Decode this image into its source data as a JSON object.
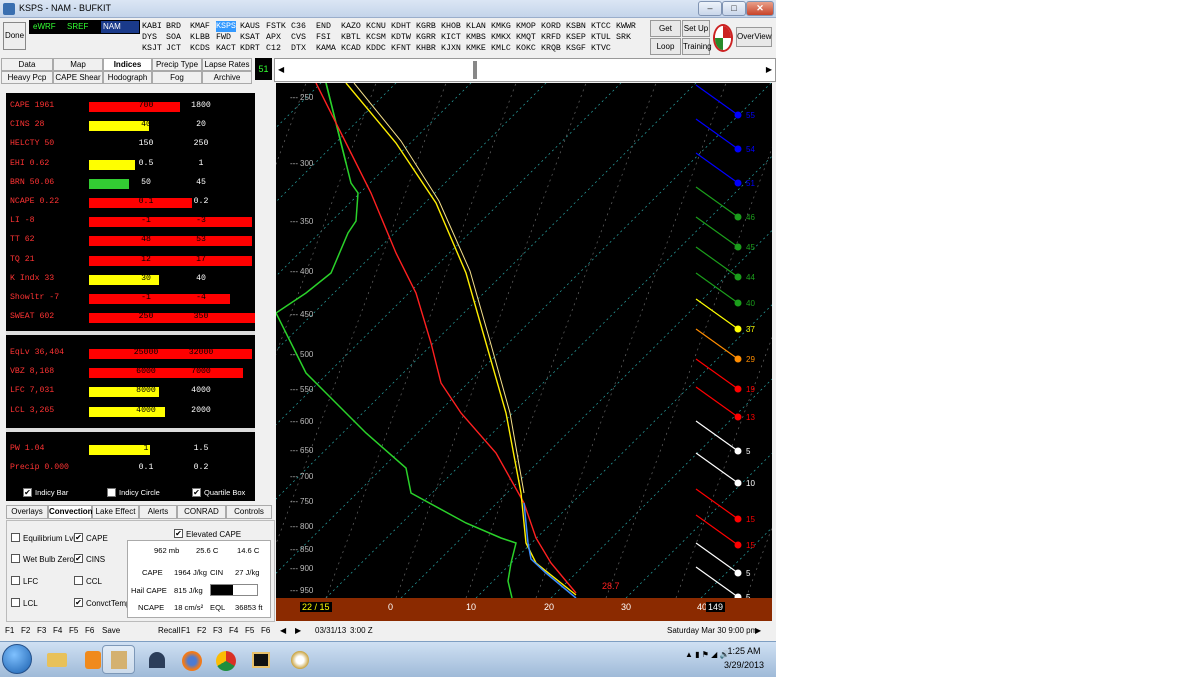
{
  "window": {
    "title": "KSPS - NAM - BUFKIT"
  },
  "toolbar": {
    "done": "Done",
    "models": [
      {
        "label": "eWRF",
        "color": "#33ff33"
      },
      {
        "label": "SREF",
        "color": "#33ff33"
      },
      {
        "label": "NAM",
        "color": "#ffffff",
        "selected": true
      }
    ],
    "station_cols": [
      [
        "KABI",
        "DYS",
        "KSJT"
      ],
      [
        "BRD",
        "SOA",
        "JCT"
      ],
      [
        "KMAF",
        "KLBB",
        "KCDS"
      ],
      [
        "KSPS",
        "FWD",
        "KACT"
      ],
      [
        "KAUS",
        "KSAT",
        "KDRT"
      ],
      [
        "FSTK",
        "APX",
        "C12"
      ],
      [
        "C36",
        "CVS",
        "DTX"
      ],
      [
        "END",
        "FSI",
        "KAMA"
      ],
      [
        "KAZO",
        "KBTL",
        "KCAD"
      ],
      [
        "KCNU",
        "KCSM",
        "KDDC"
      ],
      [
        "KDHT",
        "KDTW",
        "KFNT"
      ],
      [
        "KGRB",
        "KGRR",
        "KHBR"
      ],
      [
        "KHOB",
        "KICT",
        "KJXN"
      ],
      [
        "KLAN",
        "KMBS",
        "KMKE"
      ],
      [
        "KMKG",
        "KMKX",
        "KMLC"
      ],
      [
        "KMOP",
        "KMQT",
        "KOKC"
      ],
      [
        "KORD",
        "KRFD",
        "KRQB"
      ],
      [
        "KSBN",
        "KSEP",
        "KSGF"
      ],
      [
        "KTCC",
        "KTUL",
        "KTVC"
      ],
      [
        "KWWR",
        "SRK",
        ""
      ]
    ],
    "selected_station": "KSPS",
    "get_data": "Get Data",
    "loop": "Loop",
    "setup": "Set Up",
    "training": "Training",
    "overview": "OverView"
  },
  "main_tabs": {
    "row1": [
      "Data",
      "Map",
      "Indices",
      "Precip Type",
      "Lapse Rates"
    ],
    "row2": [
      "Heavy Pcp",
      "CAPE Shear",
      "Hodograph",
      "Fog",
      "Archive"
    ],
    "selected": "Indices",
    "forecast_hour": "51"
  },
  "indices": {
    "group1": [
      {
        "label": "CAPE 1961",
        "color": "#ff3333",
        "bar_color": "#ff0000",
        "bar_fraction": 0.55,
        "lo": "700",
        "hi": "1800"
      },
      {
        "label": "CINS 28",
        "color": "#ff3333",
        "bar_color": "#ffff00",
        "bar_fraction": 0.36,
        "lo": "40",
        "hi": "20"
      },
      {
        "label": "HELCTY 50",
        "color": "#ff3333",
        "bar_color": "",
        "bar_fraction": 0,
        "lo": "150",
        "hi": "250"
      },
      {
        "label": "EHI 0.62",
        "color": "#ff3333",
        "bar_color": "#ffff00",
        "bar_fraction": 0.28,
        "lo": "0.5",
        "hi": "1"
      },
      {
        "label": "BRN 50.06",
        "color": "#ff3333",
        "bar_color": "#33cc33",
        "bar_fraction": 0.24,
        "lo": "50",
        "hi": "45"
      },
      {
        "label": "NCAPE 0.22",
        "color": "#ff3333",
        "bar_color": "#ff0000",
        "bar_fraction": 0.62,
        "lo": "0.1",
        "hi": "0.2"
      },
      {
        "label": "LI -8",
        "color": "#ff3333",
        "bar_color": "#ff0000",
        "bar_fraction": 0.98,
        "lo": "-1",
        "hi": "-3"
      },
      {
        "label": "TT 62",
        "color": "#ff3333",
        "bar_color": "#ff0000",
        "bar_fraction": 0.98,
        "lo": "48",
        "hi": "53"
      },
      {
        "label": "TQ 21",
        "color": "#ff3333",
        "bar_color": "#ff0000",
        "bar_fraction": 0.98,
        "lo": "12",
        "hi": "17"
      },
      {
        "label": "K Indx 33",
        "color": "#ff3333",
        "bar_color": "#ffff00",
        "bar_fraction": 0.42,
        "lo": "30",
        "hi": "40"
      },
      {
        "label": "Showltr -7",
        "color": "#ff3333",
        "bar_color": "#ff0000",
        "bar_fraction": 0.85,
        "lo": "-1",
        "hi": "-4"
      },
      {
        "label": "SWEAT 602",
        "color": "#ff3333",
        "bar_color": "#ff0000",
        "bar_fraction": 1.0,
        "lo": "250",
        "hi": "350"
      }
    ],
    "group2": [
      {
        "label": "EqLv 36,404",
        "color": "#ff3333",
        "bar_color": "#ff0000",
        "bar_fraction": 0.98,
        "lo": "25000",
        "hi": "32000"
      },
      {
        "label": "VBZ 8,168",
        "color": "#ff3333",
        "bar_color": "#ff0000",
        "bar_fraction": 0.93,
        "lo": "6000",
        "hi": "7000"
      },
      {
        "label": "LFC 7,031",
        "color": "#ff3333",
        "bar_color": "#ffff00",
        "bar_fraction": 0.42,
        "lo": "8000",
        "hi": "4000"
      },
      {
        "label": "LCL 3,265",
        "color": "#ff3333",
        "bar_color": "#ffff00",
        "bar_fraction": 0.46,
        "lo": "4000",
        "hi": "2000"
      }
    ],
    "group3": [
      {
        "label": "PW 1.04",
        "color": "#ff3333",
        "bar_color": "#ffff00",
        "bar_fraction": 0.37,
        "lo": "1",
        "hi": "1.5"
      },
      {
        "label": "Precip 0.000",
        "color": "#ff3333",
        "bar_color": "",
        "bar_fraction": 0,
        "lo": "0.1",
        "hi": "0.2"
      }
    ],
    "options": [
      {
        "label": "Indicy Bar",
        "checked": true
      },
      {
        "label": "Indicy Circle",
        "checked": false
      },
      {
        "label": "Quartile Box",
        "checked": true
      }
    ]
  },
  "bottom_tabs": {
    "items": [
      "Overlays",
      "Convection",
      "Lake Effect",
      "Alerts",
      "CONRAD",
      "Controls"
    ],
    "selected": "Convection"
  },
  "convection": {
    "left_checks": [
      {
        "label": "Equilibrium Lvl",
        "checked": false
      },
      {
        "label": "Wet Bulb Zero",
        "checked": false
      },
      {
        "label": "LFC",
        "checked": false
      },
      {
        "label": "LCL",
        "checked": false
      }
    ],
    "mid_checks": [
      {
        "label": "CAPE",
        "checked": true
      },
      {
        "label": "CINS",
        "checked": true
      },
      {
        "label": "CCL",
        "checked": false
      },
      {
        "label": "ConvctTemp",
        "checked": true
      }
    ],
    "elevated": {
      "label": "Elevated CAPE",
      "checked": true
    },
    "stats": {
      "pressure": "962 mb",
      "temp": "25.6 C",
      "dewpt": "14.6 C",
      "cape_label": "CAPE",
      "cape": "1964 J/kg",
      "cin_label": "CIN",
      "cin": "27 J/kg",
      "hail_label": "Hail CAPE",
      "hail": "815 J/kg",
      "ncape_label": "NCAPE",
      "ncape": "18 cm/s²",
      "eql_label": "EQL",
      "eql": "36853 ft"
    }
  },
  "sounding": {
    "pressure_levels": [
      "250",
      "300",
      "350",
      "400",
      "450",
      "500",
      "550",
      "600",
      "650",
      "700",
      "750",
      "800",
      "850",
      "900",
      "950"
    ],
    "x_ticks": [
      "0",
      "10",
      "20",
      "30",
      "40"
    ],
    "td_td": "22 / 15",
    "sfc_temp": "28.7",
    "right_box": "149",
    "wind_speeds": [
      {
        "value": "55",
        "color": "#0000ff"
      },
      {
        "value": "54",
        "color": "#0000ff"
      },
      {
        "value": "51",
        "color": "#0000ff"
      },
      {
        "value": "46",
        "color": "#1b9e1b"
      },
      {
        "value": "45",
        "color": "#1b9e1b"
      },
      {
        "value": "44",
        "color": "#1b9e1b"
      },
      {
        "value": "40",
        "color": "#1b9e1b"
      },
      {
        "value": "37",
        "color": "#ffff00"
      },
      {
        "value": "29",
        "color": "#ff8c00"
      },
      {
        "value": "19",
        "color": "#ff0000"
      },
      {
        "value": "13",
        "color": "#ff0000"
      },
      {
        "value": "5",
        "color": "#ffffff"
      },
      {
        "value": "10",
        "color": "#ffffff"
      },
      {
        "value": "15",
        "color": "#ff0000"
      },
      {
        "value": "15",
        "color": "#ff0000"
      },
      {
        "value": "5",
        "color": "#ffffff"
      },
      {
        "value": "5",
        "color": "#ffffff"
      }
    ]
  },
  "fkeys": {
    "save": [
      "F1",
      "F2",
      "F3",
      "F4",
      "F5",
      "F6"
    ],
    "save_label": "Save",
    "recall_label": "Recall",
    "recall": [
      "F1",
      "F2",
      "F3",
      "F4",
      "F5",
      "F6"
    ]
  },
  "statusbar": {
    "date": "03/31/13",
    "time": "3:00 Z",
    "valid": "Saturday  Mar 30  9:00 pm"
  },
  "taskbar": {
    "clock_time": "1:25 AM",
    "clock_date": "3/29/2013"
  }
}
